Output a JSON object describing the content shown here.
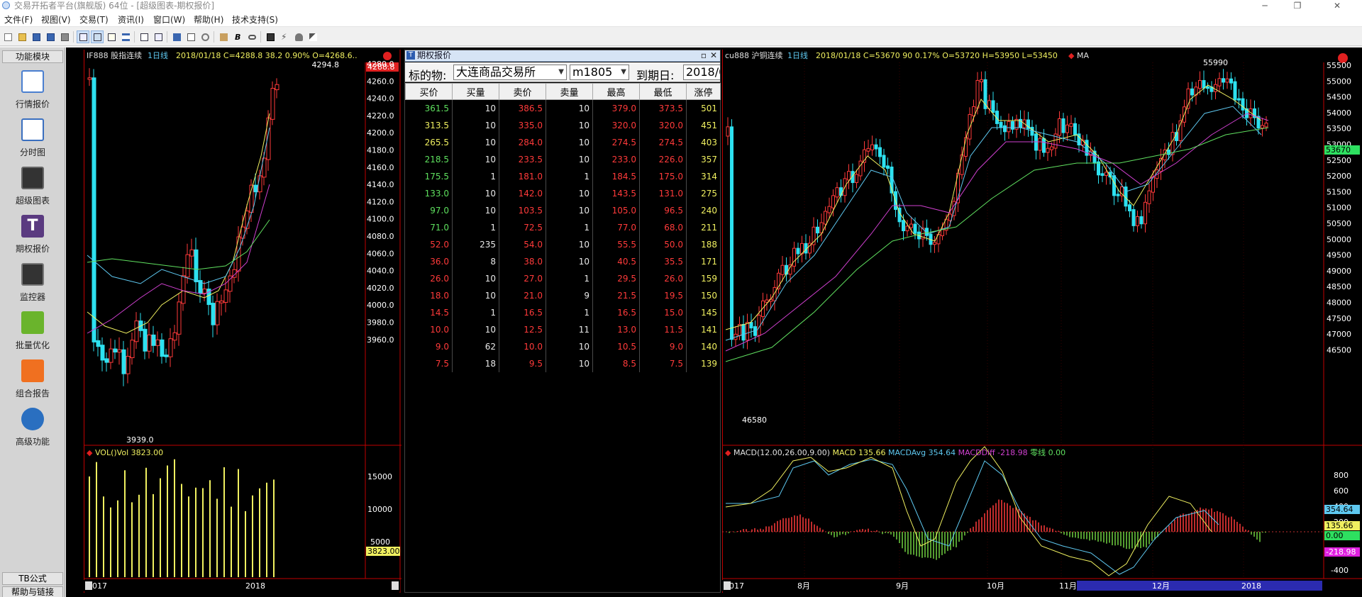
{
  "window": {
    "title": "交易开拓者平台(旗舰版) 64位 - [超级图表-期权报价]",
    "minimize": "─",
    "maximize": "❐",
    "close": "✕"
  },
  "menu": [
    "文件(F)",
    "视图(V)",
    "交易(T)",
    "资讯(I)",
    "窗口(W)",
    "帮助(H)",
    "技术支持(S)"
  ],
  "toolbar_icons": [
    "new-icon",
    "open-icon",
    "save-icon",
    "save-all-icon",
    "print-icon",
    "layout1-icon",
    "layout2-icon",
    "edit-icon",
    "list-icon",
    "window-icon",
    "window2-icon",
    "disk-icon",
    "attach-icon",
    "link-icon",
    "paste-icon",
    "bold-icon",
    "chain-icon",
    "image-icon",
    "bolt-icon",
    "person-icon",
    "brush-icon"
  ],
  "sidebar": {
    "header": "功能模块",
    "items": [
      {
        "label": "行情报价",
        "icon": "quote-icon",
        "color": "#4a7fd0"
      },
      {
        "label": "分时图",
        "icon": "timeshare-icon",
        "color": "#3a6fbf"
      },
      {
        "label": "超级图表",
        "icon": "superchart-icon",
        "color": "#505050"
      },
      {
        "label": "期权报价",
        "icon": "option-quote-icon",
        "color": "#5a3a80"
      },
      {
        "label": "监控器",
        "icon": "monitor-icon",
        "color": "#4a4a4a"
      },
      {
        "label": "批量优化",
        "icon": "batch-optimize-icon",
        "color": "#6ab42c"
      },
      {
        "label": "组合报告",
        "icon": "portfolio-report-icon",
        "color": "#f07020"
      },
      {
        "label": "高级功能",
        "icon": "advanced-icon",
        "color": "#2a6fc0"
      }
    ],
    "tb_formula": "TB公式",
    "help": "帮助与链接"
  },
  "if_chart": {
    "header": {
      "symbol": "IF888 股指连续",
      "period": "1日线",
      "info": "2018/01/18  C=4288.8  38.2  0.90%  O=4268.6.."
    },
    "last_price": "4288.8",
    "high_label": "4294.8",
    "low_label": "3939.0",
    "price_axis": [
      "4280.0",
      "4260.0",
      "4240.0",
      "4220.0",
      "4200.0",
      "4180.0",
      "4160.0",
      "4140.0",
      "4120.0",
      "4100.0",
      "4080.0",
      "4060.0",
      "4040.0",
      "4020.0",
      "4000.0",
      "3980.0",
      "3960.0"
    ],
    "vol_header": "VOL()Vol 3823.00",
    "vol_axis": [
      "15000",
      "10000",
      "5000"
    ],
    "vol_last": "3823.00",
    "time_axis": [
      "017",
      "2018"
    ]
  },
  "option_panel": {
    "title": "期权报价",
    "underlying_label": "标的物:",
    "exchange": "大连商品交易所",
    "contract": "m1805",
    "expiry_label": "到期日:",
    "expiry_value": "2018/0",
    "columns": [
      "买价",
      "买量",
      "卖价",
      "卖量",
      "最高",
      "最低",
      "涨停"
    ],
    "rows": [
      {
        "bid": "361.5",
        "bidv": "10",
        "ask": "386.5",
        "askv": "10",
        "high": "379.0",
        "low": "373.5",
        "limit": "501",
        "c": "g"
      },
      {
        "bid": "313.5",
        "bidv": "10",
        "ask": "335.0",
        "askv": "10",
        "high": "320.0",
        "low": "320.0",
        "limit": "451",
        "c": "y"
      },
      {
        "bid": "265.5",
        "bidv": "10",
        "ask": "284.0",
        "askv": "10",
        "high": "274.5",
        "low": "274.5",
        "limit": "403",
        "c": "y"
      },
      {
        "bid": "218.5",
        "bidv": "10",
        "ask": "233.5",
        "askv": "10",
        "high": "233.0",
        "low": "226.0",
        "limit": "357",
        "c": "g"
      },
      {
        "bid": "175.5",
        "bidv": "1",
        "ask": "181.0",
        "askv": "1",
        "high": "184.5",
        "low": "175.0",
        "limit": "314",
        "c": "g"
      },
      {
        "bid": "133.0",
        "bidv": "10",
        "ask": "142.0",
        "askv": "10",
        "high": "143.5",
        "low": "131.0",
        "limit": "275",
        "c": "g"
      },
      {
        "bid": "97.0",
        "bidv": "10",
        "ask": "103.5",
        "askv": "10",
        "high": "105.0",
        "low": "96.5",
        "limit": "240",
        "c": "g"
      },
      {
        "bid": "71.0",
        "bidv": "1",
        "ask": "72.5",
        "askv": "1",
        "high": "77.0",
        "low": "68.0",
        "limit": "211",
        "c": "g"
      },
      {
        "bid": "52.0",
        "bidv": "235",
        "ask": "54.0",
        "askv": "10",
        "high": "55.5",
        "low": "50.0",
        "limit": "188",
        "c": "r"
      },
      {
        "bid": "36.0",
        "bidv": "8",
        "ask": "38.0",
        "askv": "10",
        "high": "40.5",
        "low": "35.5",
        "limit": "171",
        "c": "r"
      },
      {
        "bid": "26.0",
        "bidv": "10",
        "ask": "27.0",
        "askv": "1",
        "high": "29.5",
        "low": "26.0",
        "limit": "159",
        "c": "r"
      },
      {
        "bid": "18.0",
        "bidv": "10",
        "ask": "21.0",
        "askv": "9",
        "high": "21.5",
        "low": "19.5",
        "limit": "150",
        "c": "r"
      },
      {
        "bid": "14.5",
        "bidv": "1",
        "ask": "16.5",
        "askv": "1",
        "high": "16.5",
        "low": "15.0",
        "limit": "145",
        "c": "r"
      },
      {
        "bid": "10.0",
        "bidv": "10",
        "ask": "12.5",
        "askv": "11",
        "high": "13.0",
        "low": "11.5",
        "limit": "141",
        "c": "r"
      },
      {
        "bid": "9.0",
        "bidv": "62",
        "ask": "10.0",
        "askv": "10",
        "high": "10.5",
        "low": "9.0",
        "limit": "140",
        "c": "r"
      },
      {
        "bid": "7.5",
        "bidv": "18",
        "ask": "9.5",
        "askv": "10",
        "high": "8.5",
        "low": "7.5",
        "limit": "139",
        "c": "r"
      }
    ]
  },
  "cu_chart": {
    "header": {
      "symbol": "cu888 沪铜连续",
      "period": "1日线",
      "info": "2018/01/18  C=53670  90  0.17%  O=53720  H=53950  L=53450",
      "ma": "MA"
    },
    "last_price": "53670",
    "high_label": "55990",
    "low_label": "46580",
    "price_axis": [
      "55500",
      "55000",
      "54500",
      "54000",
      "53500",
      "53000",
      "52500",
      "52000",
      "51500",
      "51000",
      "50500",
      "50000",
      "49500",
      "49000",
      "48500",
      "48000",
      "47500",
      "47000",
      "46500"
    ],
    "macd_header": {
      "main": "MACD(12.00,26.00,9.00)",
      "macd": "MACD 135.66",
      "avg": "MACDAvg 354.64",
      "diff": "MACDDiff -218.98",
      "zero": "零线 0.00"
    },
    "macd_axis": [
      "800",
      "600",
      "400",
      "200",
      "-400"
    ],
    "macd_tags": {
      "avg": "354.64",
      "macd": "135.66",
      "zero": "0.00",
      "diff": "-218.98"
    },
    "time_axis": [
      "017",
      "8月",
      "9月",
      "10月",
      "11月",
      "12月",
      "2018"
    ]
  },
  "colors": {
    "up": "#ff3a3a",
    "down": "#2de1f0",
    "ma_yellow": "#f0f060",
    "ma_cyan": "#5ec8f0",
    "ma_magenta": "#d040d0",
    "ma_green": "#60e060",
    "grid_red": "#c00000",
    "macd_green": "#70d040"
  }
}
